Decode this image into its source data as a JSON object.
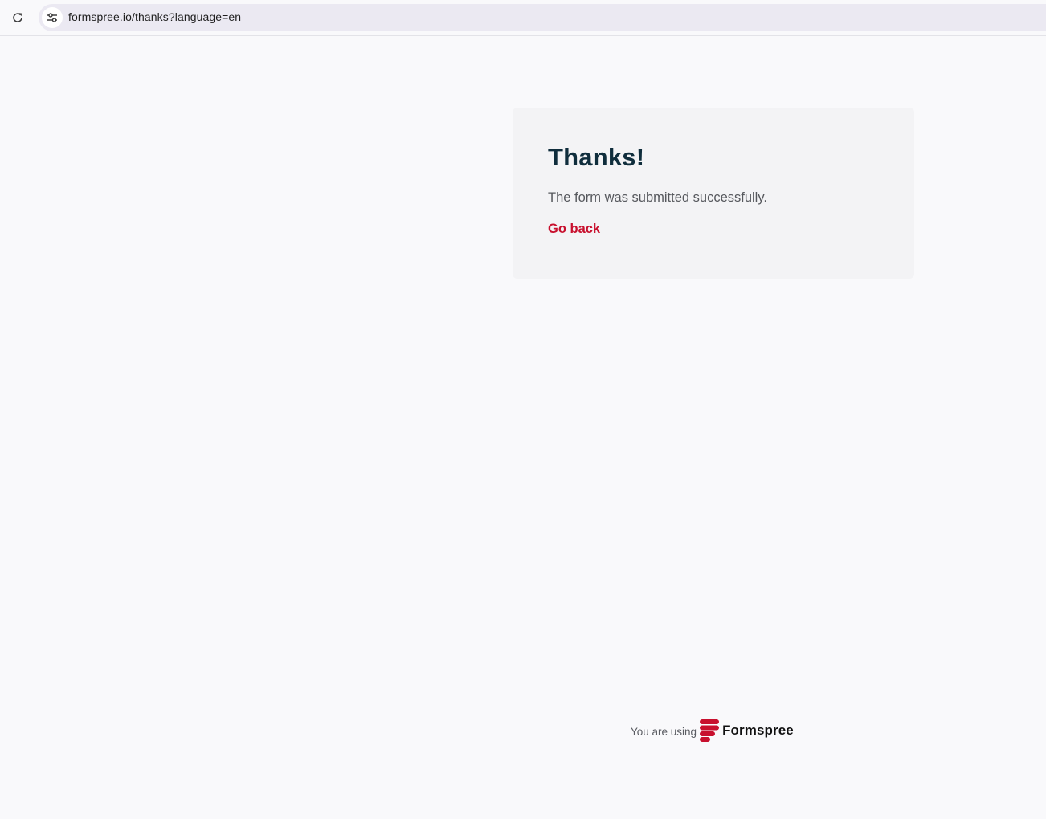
{
  "browser": {
    "url": "formspree.io/thanks?language=en",
    "reload_icon": "reload-icon",
    "site_info_icon": "tune-icon"
  },
  "card": {
    "title": "Thanks!",
    "message": "The form was submitted successfully.",
    "back_link": "Go back"
  },
  "footer": {
    "text": "You are using",
    "brand_name": "Formspree",
    "brand_icon": "formspree-logo-icon"
  },
  "colors": {
    "page_background": "#f9f9fb",
    "card_background": "#f3f3f5",
    "title": "#0f2d3c",
    "accent": "#c8102e",
    "omnibox": "#ebe9f2"
  }
}
